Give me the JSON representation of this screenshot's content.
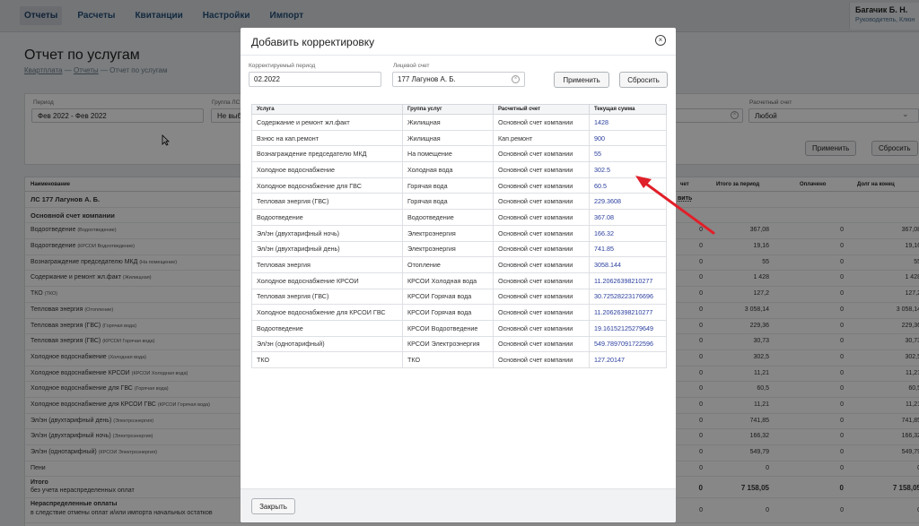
{
  "nav": {
    "items": [
      "Отчеты",
      "Расчеты",
      "Квитанции",
      "Настройки",
      "Импорт"
    ],
    "user_name": "Багачик Б. Н.",
    "user_role": "Руководитель, Клюн"
  },
  "page": {
    "title": "Отчет по услугам",
    "breadcrumb": [
      "Квартплата",
      "Отчеты",
      "Отчет по услугам"
    ],
    "breadcrumb_sep": "—"
  },
  "filters": {
    "period_label": "Период",
    "period_value": "Фев 2022 - Фев 2022",
    "group_label": "Группа ЛС",
    "group_value": "Не выб",
    "account_label": "Расчетный счет",
    "account_value": "Любой",
    "apply_label": "Применить",
    "reset_label": "Сбросить"
  },
  "main_table": {
    "headers": {
      "name": "Наименование",
      "c1": "чет",
      "c2": "Итого за период",
      "c3": "Оплачено",
      "c4": "Долг на конец"
    },
    "group_row": "ЛС 177 Лагунов А. Б.",
    "group_link": "вить",
    "account_row": "Основной счет компании",
    "rows": [
      {
        "name": "Водоотведение",
        "sub": "(Водоотведение)",
        "v1": "0",
        "v2": "367,08",
        "v3": "0",
        "v4": "367,08"
      },
      {
        "name": "Водоотведение",
        "sub": "(КРСОИ Водоотведение)",
        "v1": "0",
        "v2": "19,16",
        "v3": "0",
        "v4": "19,16"
      },
      {
        "name": "Вознаграждение председателю МКД",
        "sub": "(На помещение)",
        "v1": "0",
        "v2": "55",
        "v3": "0",
        "v4": "55"
      },
      {
        "name": "Содержание и ремонт жл.факт",
        "sub": "(Жилищная)",
        "v1": "0",
        "v2": "1 428",
        "v3": "0",
        "v4": "1 428"
      },
      {
        "name": "ТКО",
        "sub": "(ТКО)",
        "v1": "0",
        "v2": "127,2",
        "v3": "0",
        "v4": "127,2"
      },
      {
        "name": "Тепловая энергия",
        "sub": "(Отопление)",
        "v1": "0",
        "v2": "3 058,14",
        "v3": "0",
        "v4": "3 058,14"
      },
      {
        "name": "Тепловая энергия (ГВС)",
        "sub": "(Горячая вода)",
        "v1": "0",
        "v2": "229,36",
        "v3": "0",
        "v4": "229,36"
      },
      {
        "name": "Тепловая энергия (ГВС)",
        "sub": "(КРСОИ Горячая вода)",
        "v1": "0",
        "v2": "30,73",
        "v3": "0",
        "v4": "30,73"
      },
      {
        "name": "Холодное водоснабжение",
        "sub": "(Холодная вода)",
        "v1": "0",
        "v2": "302,5",
        "v3": "0",
        "v4": "302,5"
      },
      {
        "name": "Холодное водоснабжение КРСОИ",
        "sub": "(КРСОИ Холодная вода)",
        "v1": "0",
        "v2": "11,21",
        "v3": "0",
        "v4": "11,21"
      },
      {
        "name": "Холодное водоснабжение для ГВС",
        "sub": "(Горячая вода)",
        "v1": "0",
        "v2": "60,5",
        "v3": "0",
        "v4": "60,5"
      },
      {
        "name": "Холодное водоснабжение для КРСОИ ГВС",
        "sub": "(КРСОИ Горячая вода)",
        "v1": "0",
        "v2": "11,21",
        "v3": "0",
        "v4": "11,21"
      },
      {
        "name": "Эл/эн (двухтарифный день)",
        "sub": "(Электроэнергия)",
        "v1": "0",
        "v2": "741,85",
        "v3": "0",
        "v4": "741,85"
      },
      {
        "name": "Эл/эн (двухтарифный ночь)",
        "sub": "(Электроэнергия)",
        "v1": "0",
        "v2": "166,32",
        "v3": "0",
        "v4": "166,32"
      },
      {
        "name": "Эл/эн (однотарифный)",
        "sub": "(КРСОИ Электроэнергия)",
        "v1": "0",
        "v2": "549,79",
        "v3": "0",
        "v4": "549,79"
      },
      {
        "name": "Пени",
        "sub": "",
        "v1": "0",
        "v2": "0",
        "v3": "0",
        "v4": "0"
      }
    ],
    "total_label": "Итого",
    "total_sub": "без учета нераспределенных оплат",
    "total": {
      "v1": "0",
      "v2": "7 158,05",
      "v3": "0",
      "v4": "7 158,05"
    },
    "unalloc_label": "Нераспределенные оплаты",
    "unalloc_sub": "в следствие отмены оплат и/или импорта начальных остатков",
    "unalloc": {
      "v1": "0",
      "v2": "0",
      "v3": "0",
      "v4": "0"
    }
  },
  "modal": {
    "title": "Добавить корректировку",
    "period_label": "Корректируемый период",
    "period_value": "02.2022",
    "account_label": "Лицевой счет",
    "account_value": "177 Лагунов А. Б.",
    "apply_label": "Применить",
    "reset_label": "Сбросить",
    "close_label": "Закрыть",
    "table": {
      "headers": [
        "Услуга",
        "Группа услуг",
        "Расчетный счет",
        "Текущая сумма"
      ],
      "rows": [
        [
          "Содержание и ремонт жл.факт",
          "Жилищная",
          "Основной счет компании",
          "1428"
        ],
        [
          "Взнос на кап.ремонт",
          "Жилищная",
          "Кап.ремонт",
          "900"
        ],
        [
          "Вознаграждение председателю МКД",
          "На помещение",
          "Основной счет компании",
          "55"
        ],
        [
          "Холодное водоснабжение",
          "Холодная вода",
          "Основной счет компании",
          "302.5"
        ],
        [
          "Холодное водоснабжение для ГВС",
          "Горячая вода",
          "Основной счет компании",
          "60.5"
        ],
        [
          "Тепловая энергия (ГВС)",
          "Горячая вода",
          "Основной счет компании",
          "229.3608"
        ],
        [
          "Водоотведение",
          "Водоотведение",
          "Основной счет компании",
          "367.08"
        ],
        [
          "Эл/эн (двухтарифный ночь)",
          "Электроэнергия",
          "Основной счет компании",
          "166.32"
        ],
        [
          "Эл/эн (двухтарифный день)",
          "Электроэнергия",
          "Основной счет компании",
          "741.85"
        ],
        [
          "Тепловая энергия",
          "Отопление",
          "Основной счет компании",
          "3058.144"
        ],
        [
          "Холодное водоснабжение КРСОИ",
          "КРСОИ Холодная вода",
          "Основной счет компании",
          "11.20626398210277"
        ],
        [
          "Тепловая энергия (ГВС)",
          "КРСОИ Горячая вода",
          "Основной счет компании",
          "30.72528223176696"
        ],
        [
          "Холодное водоснабжение для КРСОИ ГВС",
          "КРСОИ Горячая вода",
          "Основной счет компании",
          "11.20626398210277"
        ],
        [
          "Водоотведение",
          "КРСОИ Водоотведение",
          "Основной счет компании",
          "19.16152125279649"
        ],
        [
          "Эл/эн (однотарифный)",
          "КРСОИ Электроэнергия",
          "Основной счет компании",
          "549.7897091722596"
        ],
        [
          "ТКО",
          "ТКО",
          "Основной счет компании",
          "127.20147"
        ]
      ]
    }
  },
  "colors": {
    "annotation_arrow": "#e0202a",
    "link_sum": "#2a3f9e",
    "nav_text": "#244f77"
  }
}
